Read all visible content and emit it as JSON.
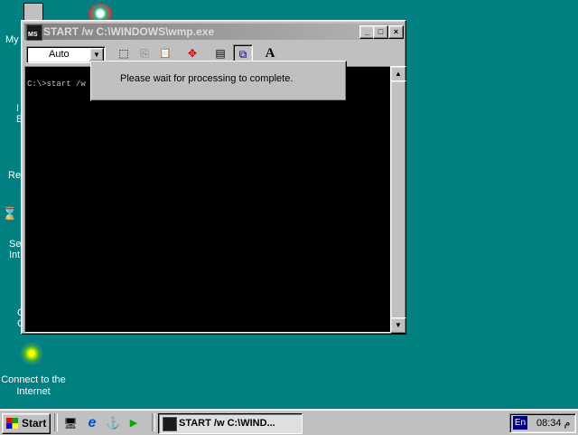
{
  "desktop": {
    "fragments": {
      "my": "My",
      "re": "Re",
      "se": "Se",
      "int": "Int",
      "i": "I",
      "e": "E",
      "o": "O",
      "c": "C"
    },
    "connect_icon_label_1": "Connect to the",
    "connect_icon_label_2": "Internet"
  },
  "window": {
    "title": "START /w C:\\WINDOWS\\wmp.exe",
    "minimize_glyph": "_",
    "maximize_glyph": "□",
    "close_glyph": "×",
    "font_select_value": "Auto",
    "console_text": "C:\\>start /w C",
    "toolbar_glyphs": {
      "mark": "⬚",
      "copy": "⎘",
      "paste": "📋",
      "fullscreen": "✥",
      "properties": "▤",
      "background": "⧉",
      "font": "A"
    }
  },
  "dialog": {
    "message": "Please wait for processing to complete."
  },
  "taskbar": {
    "start_label": "Start",
    "task_label": "START /w C:\\WIND...",
    "lang": "En",
    "clock": "08:34 م",
    "quicklaunch_glyphs": {
      "desktop": "🖥",
      "ie": "e",
      "channels": "⚓",
      "media": "▶"
    }
  },
  "colors": {
    "desktop": "#008080",
    "face": "#c0c0c0",
    "console": "#000000"
  }
}
